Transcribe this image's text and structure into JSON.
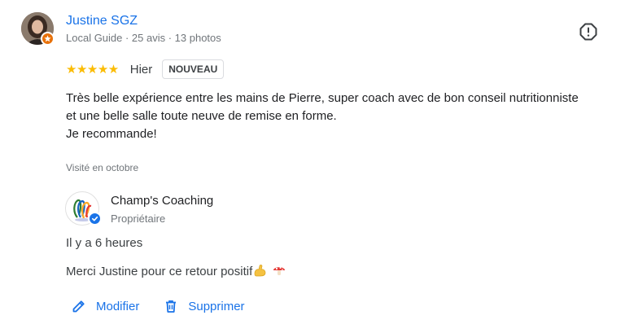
{
  "reviewer": {
    "name": "Justine SGZ",
    "meta": "Local Guide · 25 avis · 13 photos",
    "avatar_icon": "user-avatar",
    "badge_icon": "local-guide-star-icon",
    "badge_color": "#e8710a"
  },
  "rating": {
    "stars_display": "★★★★★",
    "value": 5,
    "max": 5,
    "date": "Hier",
    "badge": "NOUVEAU"
  },
  "review": {
    "lines": [
      "Très belle expérience entre les mains de Pierre, super coach avec de bon conseil nutritionniste et une belle salle toute neuve de remise en forme.",
      "Je recommande!"
    ]
  },
  "visited": "Visité en octobre",
  "owner": {
    "name": "Champ's Coaching",
    "role": "Propriétaire",
    "logo_icon": "business-logo",
    "verified_icon": "verified-check-icon",
    "reply_time": "Il y a 6 heures",
    "reply_text": "Merci Justine pour ce retour positif",
    "reply_emojis": [
      "flexed-biceps-emoji",
      "mushroom-emoji"
    ]
  },
  "actions": {
    "edit_label": "Modifier",
    "delete_label": "Supprimer"
  },
  "colors": {
    "link_blue": "#1a73e8",
    "star_yellow": "#fbbc04",
    "muted_text": "#70757a"
  }
}
